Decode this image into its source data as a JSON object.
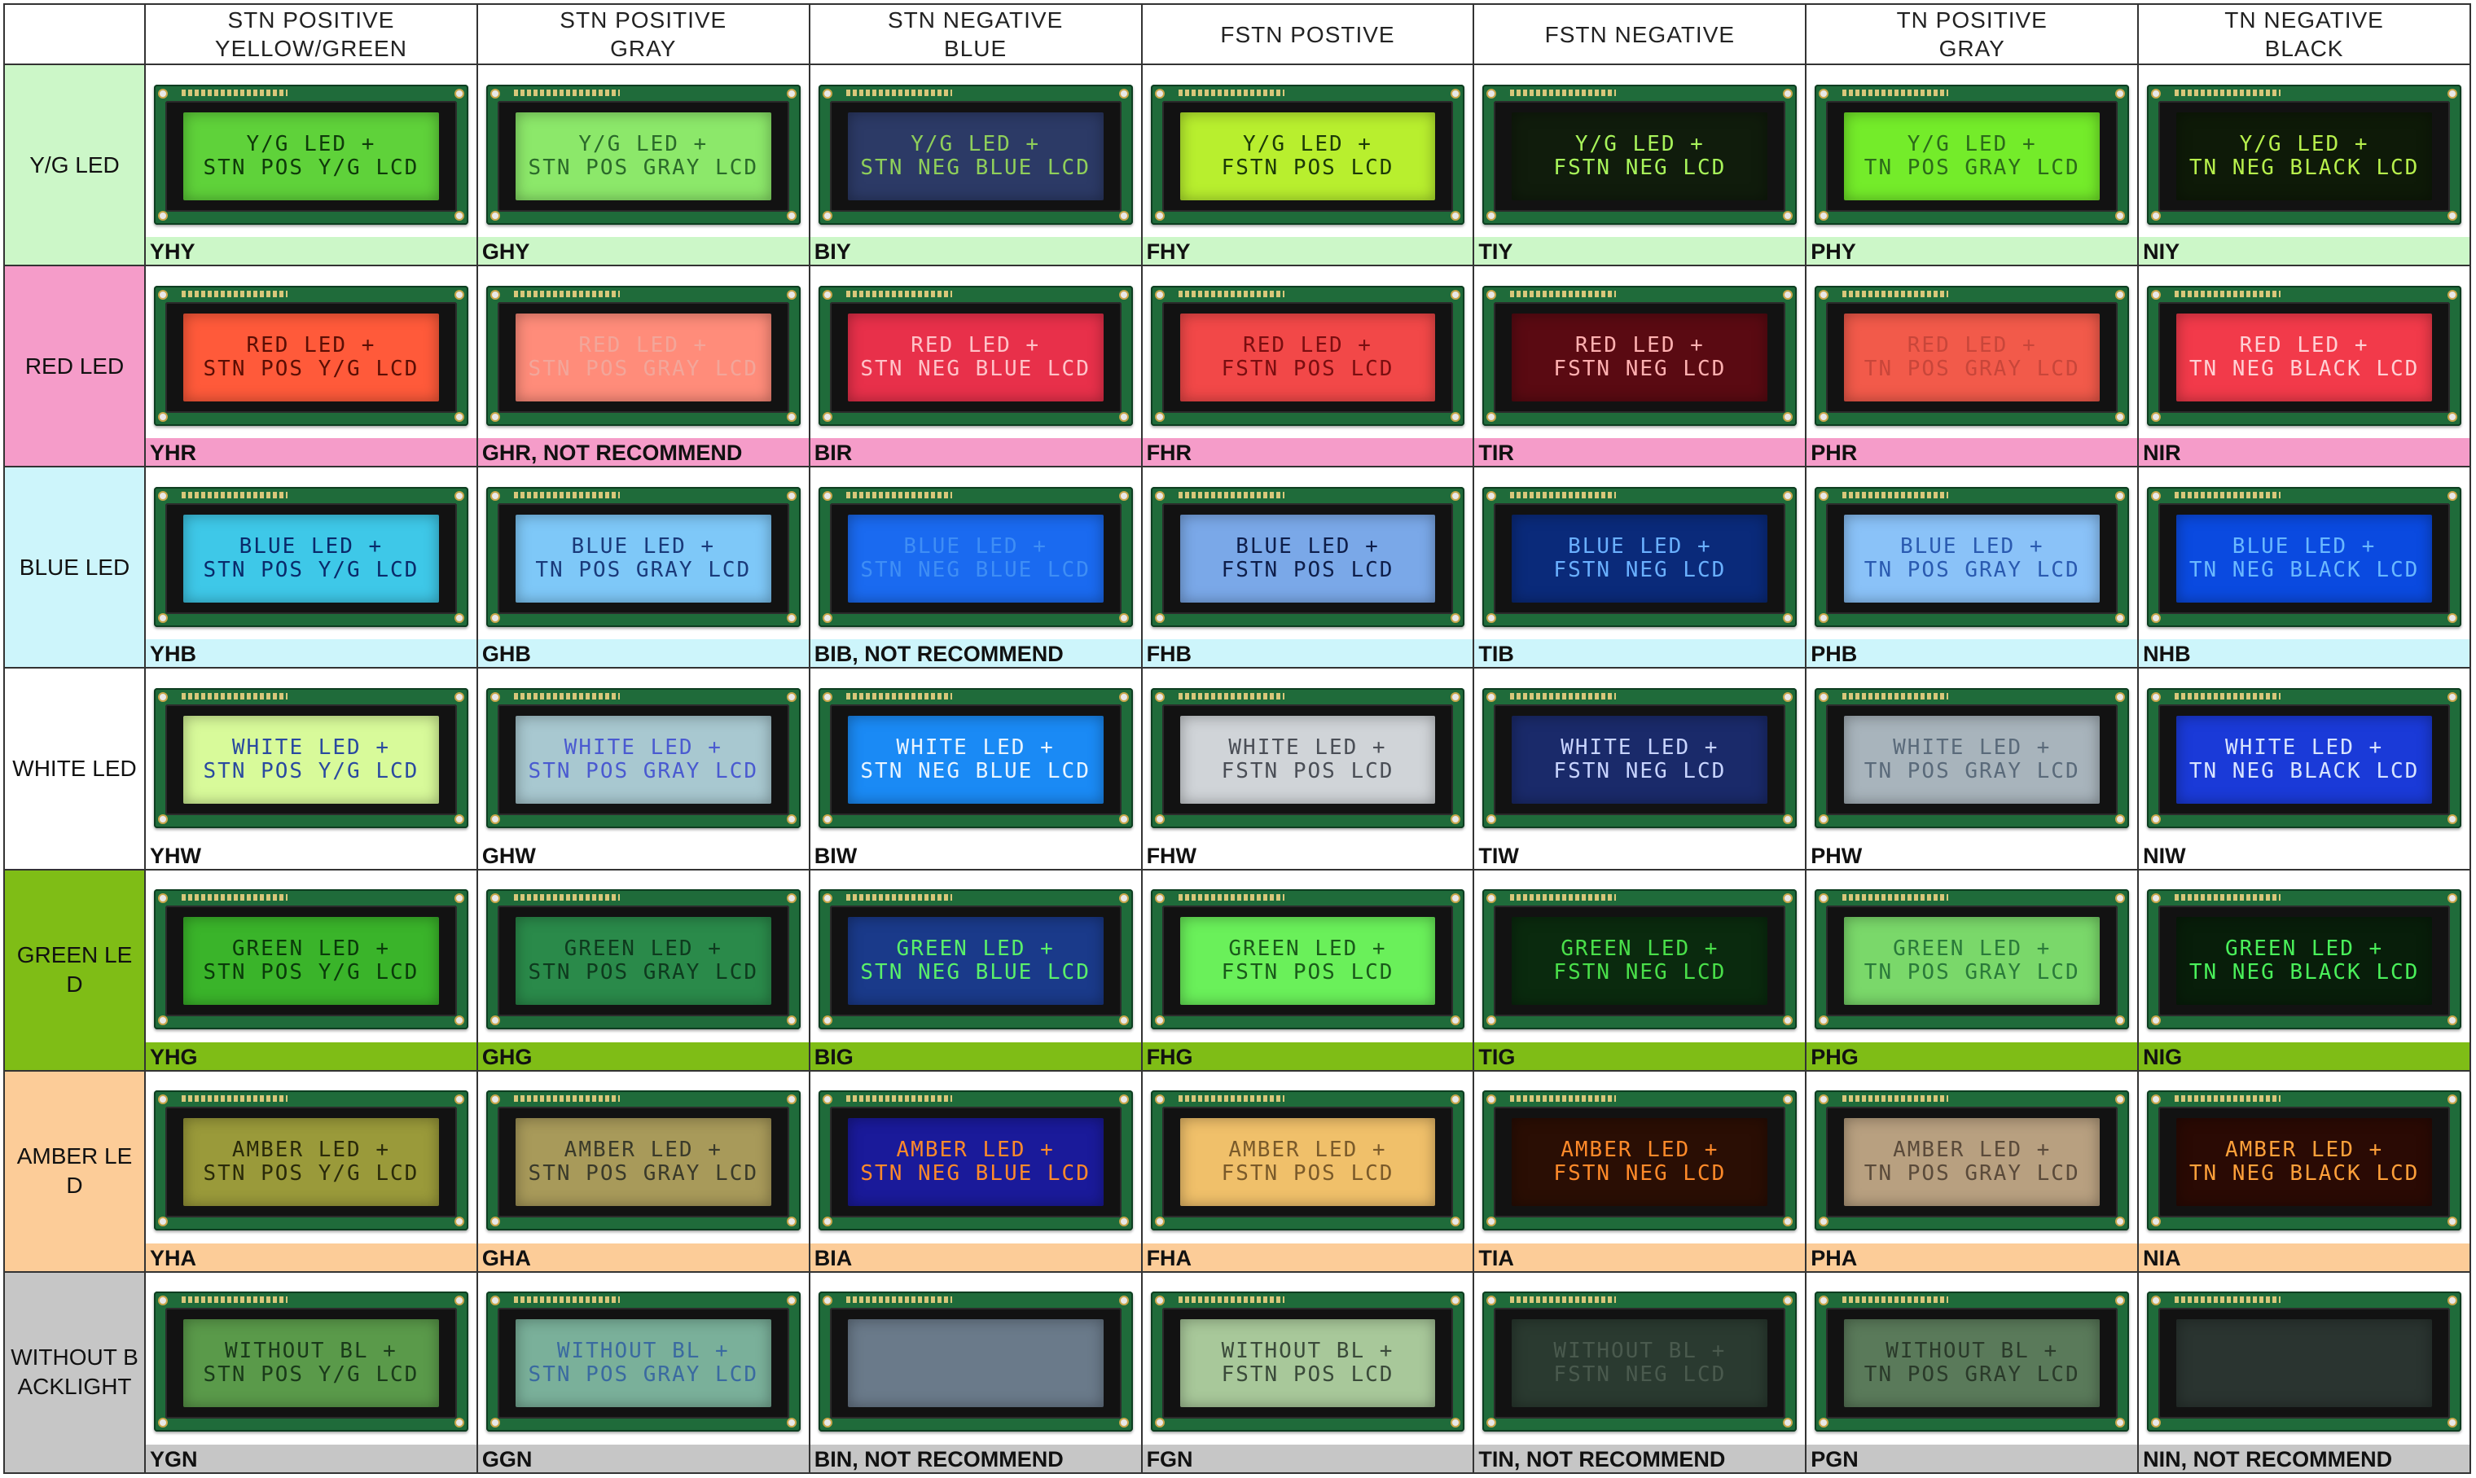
{
  "columns": [
    "STN  POSITIVE\nYELLOW/GREEN",
    "STN POSITIVE\nGRAY",
    "STN NEGATIVE\nBLUE",
    "FSTN POSTIVE",
    "FSTN NEGATIVE",
    "TN POSITIVE\nGRAY",
    "TN NEGATIVE\nBLACK"
  ],
  "rows": [
    {
      "label": "Y/G LED",
      "color": "#ccf7c8",
      "cells": [
        {
          "code": "YHY",
          "l1": "Y/G LED +",
          "l2": "STN POS Y/G LCD",
          "bg": "#5fd23a",
          "fg": "#0f3a0a"
        },
        {
          "code": "GHY",
          "l1": "Y/G LED +",
          "l2": "STN POS GRAY LCD",
          "bg": "#8ce86a",
          "fg": "#2b6a2a"
        },
        {
          "code": "BIY",
          "l1": "Y/G LED +",
          "l2": "STN NEG BLUE LCD",
          "bg": "#2c3a66",
          "fg": "#8fcf5a"
        },
        {
          "code": "FHY",
          "l1": "Y/G LED +",
          "l2": "FSTN POS LCD",
          "bg": "#b8ef2e",
          "fg": "#1c3a08"
        },
        {
          "code": "TIY",
          "l1": "Y/G LED +",
          "l2": "FSTN NEG LCD",
          "bg": "#101c0c",
          "fg": "#a8f45a"
        },
        {
          "code": "PHY",
          "l1": "Y/G LED +",
          "l2": "TN POS GRAY LCD",
          "bg": "#74ec2a",
          "fg": "#2c6a1a"
        },
        {
          "code": "NIY",
          "l1": "Y/G LED +",
          "l2": "TN NEG BLACK LCD",
          "bg": "#0e1a08",
          "fg": "#b7f04c"
        }
      ]
    },
    {
      "label": "RED LED",
      "color": "#f59cc9",
      "cells": [
        {
          "code": "YHR",
          "l1": "RED LED +",
          "l2": "STN POS Y/G LCD",
          "bg": "#ff5a3a",
          "fg": "#5a0e04"
        },
        {
          "code": "GHR, NOT RECOMMEND",
          "l1": "RED LED +",
          "l2": "STN POS GRAY LCD",
          "bg": "#ff8c7a",
          "fg": "#f2a69a"
        },
        {
          "code": "BIR",
          "l1": "RED LED +",
          "l2": "STN NEG BLUE LCD",
          "bg": "#e8304a",
          "fg": "#ffc2c8"
        },
        {
          "code": "FHR",
          "l1": "RED LED +",
          "l2": "FSTN POS LCD",
          "bg": "#f24848",
          "fg": "#7a0e10"
        },
        {
          "code": "TIR",
          "l1": "RED LED +",
          "l2": "FSTN NEG LCD",
          "bg": "#5a0a12",
          "fg": "#ffb0b0"
        },
        {
          "code": "PHR",
          "l1": "RED LED +",
          "l2": "TN POS GRAY LCD",
          "bg": "#f25a4a",
          "fg": "#c8463a"
        },
        {
          "code": "NIR",
          "l1": "RED LED +",
          "l2": "TN NEG BLACK LCD",
          "bg": "#f23a4a",
          "fg": "#ffd0d4"
        }
      ]
    },
    {
      "label": "BLUE LED",
      "color": "#cdf5fb",
      "cells": [
        {
          "code": "YHB",
          "l1": "BLUE LED +",
          "l2": "STN POS Y/G LCD",
          "bg": "#3ec8e8",
          "fg": "#0a2a6a"
        },
        {
          "code": "GHB",
          "l1": "BLUE LED +",
          "l2": "TN POS GRAY LCD",
          "bg": "#7ec8f8",
          "fg": "#1a3a7a"
        },
        {
          "code": "BIB, NOT RECOMMEND",
          "l1": "BLUE LED +",
          "l2": "STN NEG BLUE LCD",
          "bg": "#1a6af0",
          "fg": "#3f8ef5"
        },
        {
          "code": "FHB",
          "l1": "BLUE LED +",
          "l2": "FSTN POS LCD",
          "bg": "#7aa8e8",
          "fg": "#0e1e4a"
        },
        {
          "code": "TIB",
          "l1": "BLUE LED +",
          "l2": "FSTN NEG LCD",
          "bg": "#0a2a7a",
          "fg": "#6ab0ff"
        },
        {
          "code": "PHB",
          "l1": "BLUE LED +",
          "l2": "TN POS GRAY LCD",
          "bg": "#8ac2f8",
          "fg": "#2a5ab0"
        },
        {
          "code": "NHB",
          "l1": "BLUE LED +",
          "l2": "TN NEG BLACK LCD",
          "bg": "#0a4ae0",
          "fg": "#6ab8ff"
        }
      ]
    },
    {
      "label": "WHITE LED",
      "color": "#ffffff",
      "cells": [
        {
          "code": "YHW",
          "l1": "WHITE LED +",
          "l2": "STN POS Y/G LCD",
          "bg": "#d8fa9a",
          "fg": "#2a4aa0"
        },
        {
          "code": "GHW",
          "l1": "WHITE LED +",
          "l2": "STN POS GRAY LCD",
          "bg": "#a8c8d0",
          "fg": "#4a5ad0"
        },
        {
          "code": "BIW",
          "l1": "WHITE LED +",
          "l2": "STN NEG BLUE LCD",
          "bg": "#1a8af5",
          "fg": "#e8f4ff"
        },
        {
          "code": "FHW",
          "l1": "WHITE LED +",
          "l2": "FSTN POS LCD",
          "bg": "#d0d4d8",
          "fg": "#4a4e56"
        },
        {
          "code": "TIW",
          "l1": "WHITE LED +",
          "l2": "FSTN NEG LCD",
          "bg": "#1a2a6a",
          "fg": "#c8d4ff"
        },
        {
          "code": "PHW",
          "l1": "WHITE LED +",
          "l2": "TN POS GRAY LCD",
          "bg": "#a8b4bc",
          "fg": "#5a6a7a"
        },
        {
          "code": "NIW",
          "l1": "WHITE LED +",
          "l2": "TN NEG BLACK LCD",
          "bg": "#1a3ad8",
          "fg": "#d8e4ff"
        }
      ]
    },
    {
      "label": "GREEN LED",
      "color": "#7fbd16",
      "cells": [
        {
          "code": "YHG",
          "l1": "GREEN LED +",
          "l2": "STN POS Y/G LCD",
          "bg": "#3ab42a",
          "fg": "#0a3a0a"
        },
        {
          "code": "GHG",
          "l1": "GREEN LED +",
          "l2": "STN POS GRAY LCD",
          "bg": "#2a8a4a",
          "fg": "#0e3a1e"
        },
        {
          "code": "BIG",
          "l1": "GREEN LED +",
          "l2": "STN NEG BLUE LCD",
          "bg": "#1a3a8a",
          "fg": "#5af06a"
        },
        {
          "code": "FHG",
          "l1": "GREEN LED +",
          "l2": "FSTN POS LCD",
          "bg": "#6af05a",
          "fg": "#1a5a1a"
        },
        {
          "code": "TIG",
          "l1": "GREEN LED +",
          "l2": "FSTN NEG LCD",
          "bg": "#0a2a0e",
          "fg": "#4ae04a"
        },
        {
          "code": "PHG",
          "l1": "GREEN LED +",
          "l2": "TN POS GRAY LCD",
          "bg": "#7ad86a",
          "fg": "#2a7a3a"
        },
        {
          "code": "NIG",
          "l1": "GREEN LED +",
          "l2": "TN NEG BLACK LCD",
          "bg": "#081e0a",
          "fg": "#4af05a"
        }
      ]
    },
    {
      "label": "AMBER LED",
      "color": "#fccc98",
      "cells": [
        {
          "code": "YHA",
          "l1": "AMBER LED +",
          "l2": "STN POS Y/G LCD",
          "bg": "#9a9a3a",
          "fg": "#2a2a0a"
        },
        {
          "code": "GHA",
          "l1": "AMBER LED +",
          "l2": "STN POS GRAY LCD",
          "bg": "#a89a5a",
          "fg": "#3a3a2a"
        },
        {
          "code": "BIA",
          "l1": "AMBER LED +",
          "l2": "STN NEG BLUE LCD",
          "bg": "#1a1a9a",
          "fg": "#ff8a2a"
        },
        {
          "code": "FHA",
          "l1": "AMBER LED +",
          "l2": "FSTN POS LCD",
          "bg": "#f0c06a",
          "fg": "#7a5a2a"
        },
        {
          "code": "TIA",
          "l1": "AMBER LED +",
          "l2": "FSTN NEG LCD",
          "bg": "#2a0e04",
          "fg": "#ff8a2a"
        },
        {
          "code": "PHA",
          "l1": "AMBER LED +",
          "l2": "TN POS GRAY LCD",
          "bg": "#b8a080",
          "fg": "#5a4a3a"
        },
        {
          "code": "NIA",
          "l1": "AMBER LED +",
          "l2": "TN NEG BLACK LCD",
          "bg": "#2a0a04",
          "fg": "#ffa03a"
        }
      ]
    },
    {
      "label": "WITHOUT BACKLIGHT",
      "color": "#c6c6c6",
      "cells": [
        {
          "code": "YGN",
          "l1": "WITHOUT BL +",
          "l2": "STN POS Y/G LCD",
          "bg": "#5a9a4a",
          "fg": "#1a3a1a"
        },
        {
          "code": "GGN",
          "l1": "WITHOUT BL +",
          "l2": "STN POS GRAY LCD",
          "bg": "#7ab09a",
          "fg": "#3a6aa0"
        },
        {
          "code": "BIN, NOT RECOMMEND",
          "l1": "",
          "l2": "",
          "bg": "#6a7a8a",
          "fg": "#6a7a8a"
        },
        {
          "code": "FGN",
          "l1": "WITHOUT BL +",
          "l2": "FSTN POS LCD",
          "bg": "#a8c89a",
          "fg": "#3a4a3a"
        },
        {
          "code": "TIN, NOT RECOMMEND",
          "l1": "WITHOUT BL +",
          "l2": "FSTN NEG LCD",
          "bg": "#2a3a30",
          "fg": "#4a5a4e"
        },
        {
          "code": "PGN",
          "l1": "WITHOUT BL +",
          "l2": "TN POS GRAY LCD",
          "bg": "#5a7a5a",
          "fg": "#2a3a2a"
        },
        {
          "code": "NIN, NOT RECOMMEND",
          "l1": "",
          "l2": "",
          "bg": "#2a3430",
          "fg": "#2a3430"
        }
      ]
    }
  ]
}
